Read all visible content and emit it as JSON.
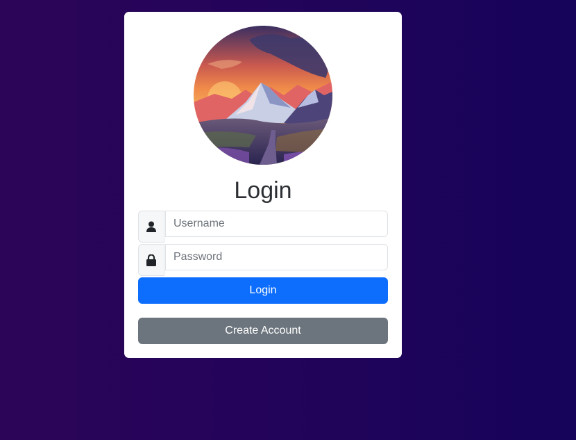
{
  "login_card": {
    "title": "Login",
    "avatar": "mountain-sunset-landscape",
    "username": {
      "placeholder": "Username",
      "value": "",
      "icon": "user-icon"
    },
    "password": {
      "placeholder": "Password",
      "value": "",
      "icon": "lock-icon"
    },
    "login_label": "Login",
    "create_account_label": "Create Account"
  },
  "colors": {
    "background_start": "#2c0558",
    "background_end": "#16035a",
    "primary": "#0d6efd",
    "secondary": "#6c757d",
    "card": "#ffffff"
  }
}
